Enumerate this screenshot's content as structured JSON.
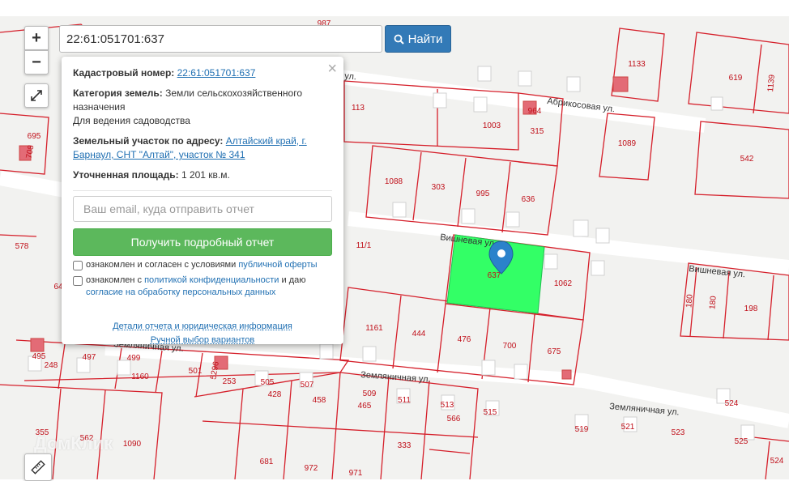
{
  "search": {
    "value": "22:61:051701:637",
    "button_label": "Найти"
  },
  "zoom": {
    "in_label": "+",
    "out_label": "−"
  },
  "popup": {
    "close_label": "×",
    "cadastral_label": "Кадастровый номер:",
    "cadastral_value": "22:61:051701:637",
    "category_label": "Категория земель:",
    "category_value": "Земли сельскохозяйственного назначения",
    "usage_value": "Для ведения садоводства",
    "address_label": "Земельный участок по адресу:",
    "address_value": "Алтайский край, г. Барнаул, СНТ \"Алтай\", участок № 341",
    "area_label": "Уточненная площадь:",
    "area_value": "1 201 кв.м.",
    "email_placeholder": "Ваш email, куда отправить отчет",
    "report_button": "Получить подробный отчет",
    "check1_text": "ознакомлен и согласен с условиями",
    "check1_link": "публичной оферты",
    "check2_text": "ознакомлен с",
    "check2_link": "политикой конфиденциальности",
    "check2_and": "и даю",
    "check2_link2": "согласие на обработку персональных данных",
    "details_link": "Детали отчета и юридическая информация",
    "manual_link": "Ручной выбор вариантов"
  },
  "map": {
    "watermark": "ДомКлик",
    "streets": [
      "Абрикосовая ул.",
      "Вишневая ул.",
      "Вишневая ул.",
      "Земляничная ул.",
      "Земляничная ул.",
      "Земляничная ул.",
      "ул."
    ],
    "plot_numbers": [
      "987",
      "1133",
      "619",
      "1139",
      "113",
      "1003",
      "315",
      "964",
      "1089",
      "542",
      "695",
      "708",
      "1088",
      "303",
      "995",
      "636",
      "578",
      "637",
      "1062",
      "180",
      "180",
      "198",
      "1161",
      "444",
      "476",
      "700",
      "675",
      "495",
      "248",
      "497",
      "499",
      "1160",
      "501",
      "5296",
      "253",
      "505",
      "428",
      "507",
      "458",
      "509",
      "465",
      "511",
      "513",
      "566",
      "515",
      "519",
      "521",
      "523",
      "524",
      "525",
      "355",
      "562",
      "1090",
      "681",
      "972",
      "971",
      "333",
      "524",
      "11/1",
      "64"
    ],
    "highlight_color": "#33ff66"
  }
}
